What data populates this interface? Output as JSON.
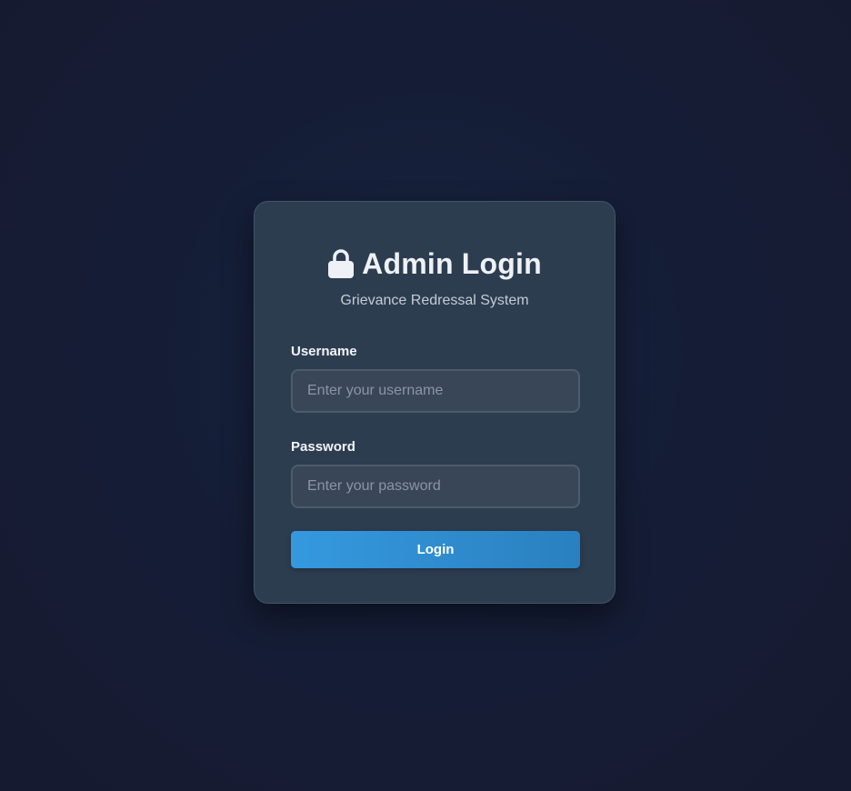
{
  "login": {
    "icon": "lock-icon",
    "title": "Admin Login",
    "subtitle": "Grievance Redressal System",
    "username": {
      "label": "Username",
      "placeholder": "Enter your username",
      "value": ""
    },
    "password": {
      "label": "Password",
      "placeholder": "Enter your password",
      "value": ""
    },
    "submit_label": "Login"
  },
  "colors": {
    "background": "#151d36",
    "card": "#2d3d50",
    "input": "#394657",
    "button": "#3599df",
    "text": "#eef1f5"
  }
}
